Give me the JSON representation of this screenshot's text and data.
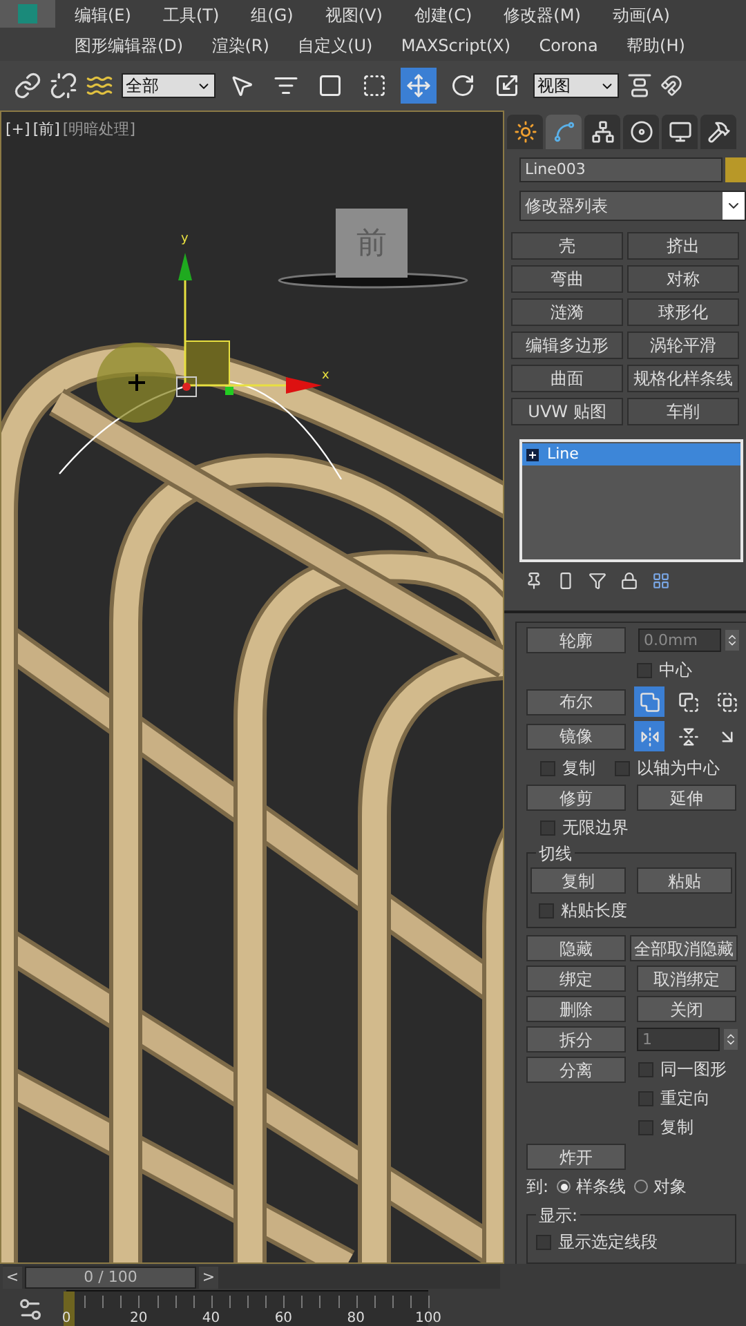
{
  "menu": [
    {
      "items": [
        "编辑(E)",
        "工具(T)",
        "组(G)",
        "视图(V)",
        "创建(C)",
        "修改器(M)",
        "动画(A)"
      ]
    },
    {
      "items": [
        "图形编辑器(D)",
        "渲染(R)",
        "自定义(U)",
        "MAXScript(X)",
        "Corona",
        "帮助(H)"
      ]
    }
  ],
  "toolbar": {
    "selection_filter": "全部",
    "reference_coord": "视图",
    "tools": [
      {
        "kind": "select-object",
        "selected": false
      },
      {
        "kind": "select-by-name",
        "selected": false
      },
      {
        "kind": "region",
        "selected": false
      },
      {
        "kind": "crossing",
        "selected": false
      },
      {
        "kind": "move",
        "selected": true
      },
      {
        "kind": "rotate",
        "selected": false
      },
      {
        "kind": "scale",
        "selected": false
      }
    ]
  },
  "viewport": {
    "labels": [
      "[+]",
      "[前]",
      "[明暗处理]"
    ],
    "viewcube_label": "前",
    "axes": {
      "y": "y",
      "x": "x"
    }
  },
  "command_panel": {
    "tabs": [
      {
        "kind": "create",
        "selected": false
      },
      {
        "kind": "modify",
        "selected": true
      },
      {
        "kind": "hierarchy",
        "selected": false
      },
      {
        "kind": "motion",
        "selected": false
      },
      {
        "kind": "display",
        "selected": false
      },
      {
        "kind": "utilities",
        "selected": false
      }
    ],
    "object_name": "Line003",
    "modifier_list": "修改器列表",
    "modifier_buttons": [
      "壳",
      "挤出",
      "弯曲",
      "对称",
      "涟漪",
      "球形化",
      "编辑多边形",
      "涡轮平滑",
      "曲面",
      "规格化样条线",
      "UVW 贴图",
      "车削"
    ],
    "stack": [
      {
        "label": "Line",
        "selected": true
      }
    ],
    "rollout": {
      "outline": {
        "label": "轮廓",
        "value": "0.0mm"
      },
      "center": {
        "label": "中心",
        "checked": false
      },
      "boolean": {
        "label": "布尔",
        "modes": [
          {
            "selected": true
          },
          {
            "selected": false
          },
          {
            "selected": false
          }
        ]
      },
      "mirror": {
        "label": "镜像",
        "modes": [
          {
            "selected": true
          },
          {
            "selected": false
          },
          {
            "selected": false
          }
        ]
      },
      "mirror_options": [
        {
          "label": "复制",
          "checked": false
        },
        {
          "label": "以轴为中心",
          "checked": false
        }
      ],
      "trim": "修剪",
      "extend": "延伸",
      "infinite_bounds": {
        "label": "无限边界",
        "checked": false
      },
      "tangent": {
        "title": "切线",
        "copy": "复制",
        "paste": "粘贴",
        "paste_length": {
          "label": "粘贴长度",
          "checked": false
        }
      },
      "hide": "隐藏",
      "unhide_all": "全部取消隐藏",
      "bind": "绑定",
      "unbind": "取消绑定",
      "delete": "删除",
      "close": "关闭",
      "divide": {
        "label": "拆分",
        "value": "1"
      },
      "detach": "分离",
      "detach_options": [
        {
          "label": "同一图形",
          "checked": false
        },
        {
          "label": "重定向",
          "checked": false
        },
        {
          "label": "复制",
          "checked": false
        }
      ],
      "explode": "炸开",
      "to": {
        "label": "到:",
        "options": [
          {
            "label": "样条线",
            "selected": true
          },
          {
            "label": "对象",
            "selected": false
          }
        ]
      },
      "display": {
        "title": "显示:",
        "show_selected": {
          "label": "显示选定线段",
          "checked": false
        }
      }
    }
  },
  "timeline": {
    "prev": "<",
    "frame": "0 / 100",
    "next": ">",
    "level": 0,
    "ticks": [
      "0",
      "20",
      "40",
      "60",
      "80",
      "100"
    ]
  }
}
